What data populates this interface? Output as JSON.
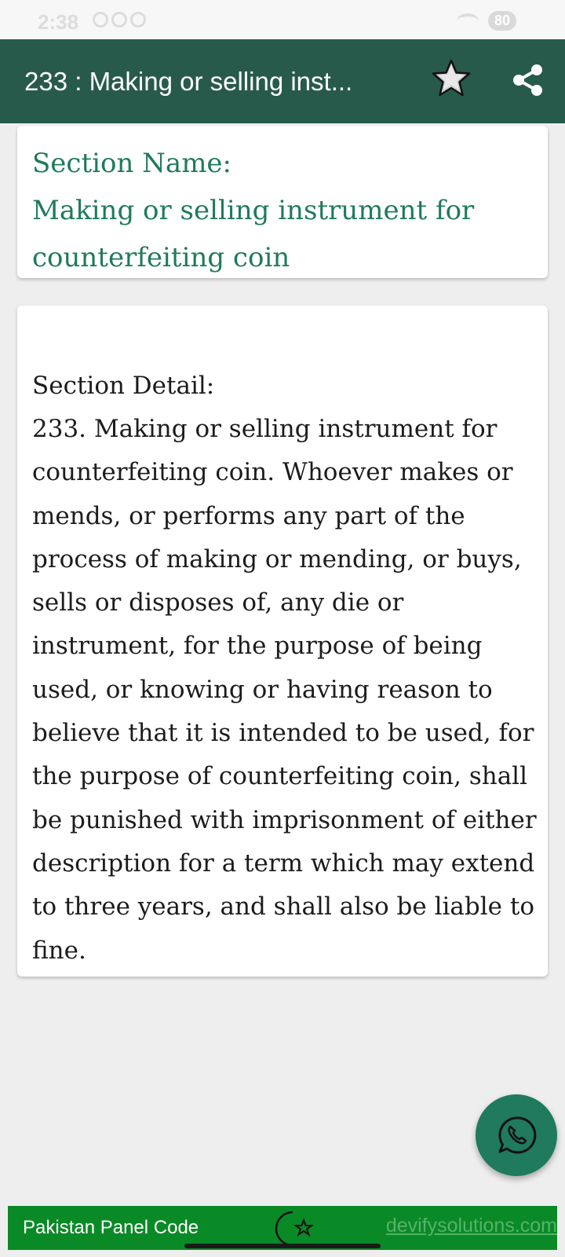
{
  "status_bar": {
    "time": "2:38",
    "battery": "80"
  },
  "app_bar": {
    "title": "233 : Making or selling inst...",
    "star_icon": "star-icon",
    "share_icon": "share-icon",
    "color": "#285a4c"
  },
  "section_name_card": {
    "label": "Section Name:",
    "value": "Making or selling instrument for counterfeiting coin",
    "color": "#1f7a5e"
  },
  "section_detail_card": {
    "label": "Section Detail:",
    "body": "233. Making or selling instrument for counterfeiting coin. Whoever makes or mends, or performs any part of the process of making or mending, or buys, sells or disposes of, any die or instrument, for the purpose of being used, or knowing or having reason to believe that it is intended to be used, for the purpose of counterfeiting coin, shall be punished with imprisonment of either description for a term which may extend to three years, and shall also be liable to fine."
  },
  "fab": {
    "icon": "whatsapp-icon",
    "color": "#1f7a5e"
  },
  "footer": {
    "title": "Pakistan Panel Code",
    "logo_icon": "crescent-star-icon",
    "link": "devifysolutions.com",
    "color": "#0a8a26"
  }
}
